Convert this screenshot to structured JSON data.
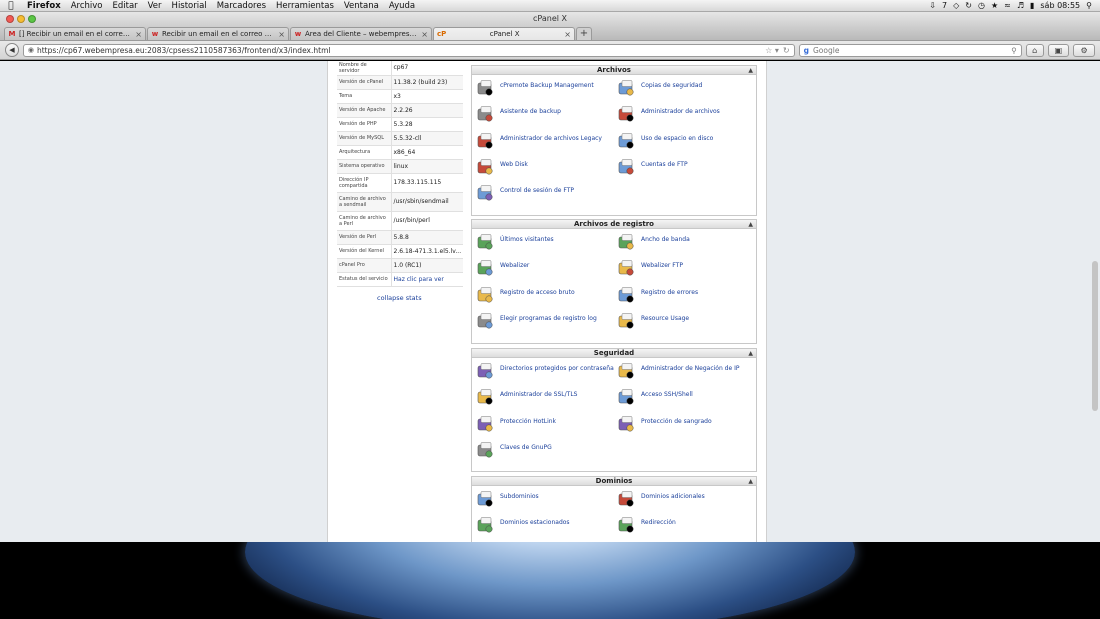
{
  "menubar": {
    "app": "Firefox",
    "items": [
      "Archivo",
      "Editar",
      "Ver",
      "Historial",
      "Marcadores",
      "Herramientas",
      "Ventana",
      "Ayuda"
    ],
    "status_number": "7",
    "clock": "sáb 08:55"
  },
  "window": {
    "title": "cPanel X"
  },
  "tabs": [
    {
      "title": "[] Recibir un email en el correo ...",
      "favicon": "M"
    },
    {
      "title": "Recibir un email en el correo de...",
      "favicon": "w"
    },
    {
      "title": "Área del Cliente – webempresa...",
      "favicon": "w"
    },
    {
      "title": "cPanel X",
      "favicon": "cP"
    }
  ],
  "navbar": {
    "url": "https://cp67.webempresa.eu:2083/cpsess2110587363/frontend/x3/index.html",
    "search_placeholder": "Google"
  },
  "stats": [
    {
      "key": "Nombre de servidor",
      "value": "cp67"
    },
    {
      "key": "Versión de cPanel",
      "value": "11.38.2 (build 23)"
    },
    {
      "key": "Tema",
      "value": "x3"
    },
    {
      "key": "Versión de Apache",
      "value": "2.2.26"
    },
    {
      "key": "Versión de PHP",
      "value": "5.3.28"
    },
    {
      "key": "Versión de MySQL",
      "value": "5.5.32-cll"
    },
    {
      "key": "Arquitectura",
      "value": "x86_64"
    },
    {
      "key": "Sistema operativo",
      "value": "linux"
    },
    {
      "key": "Dirección IP compartida",
      "value": "178.33.115.115"
    },
    {
      "key": "Camino de archivo a sendmail",
      "value": "/usr/sbin/sendmail"
    },
    {
      "key": "Camino de archivo a Perl",
      "value": "/usr/bin/perl"
    },
    {
      "key": "Versión de Perl",
      "value": "5.8.8"
    },
    {
      "key": "Versión del Kernel",
      "value": "2.6.18-471.3.1.el5.lv..."
    },
    {
      "key": "cPanel Pro",
      "value": "1.0 (RC1)"
    },
    {
      "key": "Estatus del servicio",
      "value": "Haz clic para ver"
    }
  ],
  "collapse_label": "collapse stats",
  "sections": [
    {
      "title": "Archivos",
      "items": [
        {
          "label": "cPremote Backup Management",
          "icon": "backup-management-icon"
        },
        {
          "label": "Copias de seguridad",
          "icon": "backup-drive-icon"
        },
        {
          "label": "Asistente de backup",
          "icon": "backup-wizard-icon"
        },
        {
          "label": "Administrador de archivos",
          "icon": "file-manager-icon"
        },
        {
          "label": "Administrador de archivos Legacy",
          "icon": "file-manager-legacy-icon"
        },
        {
          "label": "Uso de espacio en disco",
          "icon": "disk-usage-icon"
        },
        {
          "label": "Web Disk",
          "icon": "web-disk-icon"
        },
        {
          "label": "Cuentas de FTP",
          "icon": "ftp-accounts-icon"
        },
        {
          "label": "Control de sesión de FTP",
          "icon": "ftp-session-icon"
        }
      ]
    },
    {
      "title": "Archivos de registro",
      "items": [
        {
          "label": "Últimos visitantes",
          "icon": "latest-visitors-icon"
        },
        {
          "label": "Ancho de banda",
          "icon": "bandwidth-icon"
        },
        {
          "label": "Webalizer",
          "icon": "webalizer-icon"
        },
        {
          "label": "Webalizer FTP",
          "icon": "webalizer-ftp-icon"
        },
        {
          "label": "Registro de acceso bruto",
          "icon": "raw-access-log-icon"
        },
        {
          "label": "Registro de errores",
          "icon": "error-log-icon"
        },
        {
          "label": "Elegir programas de registro log",
          "icon": "log-programs-icon"
        },
        {
          "label": "Resource Usage",
          "icon": "resource-usage-icon"
        }
      ]
    },
    {
      "title": "Seguridad",
      "items": [
        {
          "label": "Directorios protegidos por contraseña",
          "icon": "password-directory-icon"
        },
        {
          "label": "Administrador de Negación de IP",
          "icon": "ip-deny-icon"
        },
        {
          "label": "Administrador de SSL/TLS",
          "icon": "ssl-tls-icon"
        },
        {
          "label": "Acceso SSH/Shell",
          "icon": "ssh-shell-icon"
        },
        {
          "label": "Protección HotLink",
          "icon": "hotlink-protection-icon"
        },
        {
          "label": "Protección de sangrado",
          "icon": "leech-protection-icon"
        },
        {
          "label": "Claves de GnuPG",
          "icon": "gnupg-keys-icon"
        }
      ]
    },
    {
      "title": "Dominios",
      "items": [
        {
          "label": "Subdominios",
          "icon": "subdomains-icon"
        },
        {
          "label": "Dominios adicionales",
          "icon": "addon-domains-icon"
        },
        {
          "label": "Dominios estacionados",
          "icon": "parked-domains-icon"
        },
        {
          "label": "Redirección",
          "icon": "redirects-icon"
        }
      ]
    }
  ],
  "colors": {
    "link": "#1a3f9a",
    "section_header": "#dcdcdc",
    "page_bg": "#e8ecf0"
  }
}
